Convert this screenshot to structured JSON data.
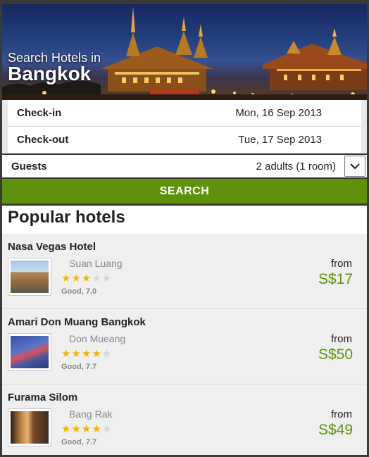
{
  "hero": {
    "subtitle": "Search Hotels in",
    "city": "Bangkok"
  },
  "form": {
    "checkin": {
      "label": "Check-in",
      "value": "Mon, 16 Sep 2013"
    },
    "checkout": {
      "label": "Check-out",
      "value": "Tue, 17 Sep 2013"
    },
    "guests": {
      "label": "Guests",
      "value": "2 adults (1 room)"
    },
    "search_label": "SEARCH"
  },
  "popular": {
    "title": "Popular hotels",
    "hotels": [
      {
        "name": "Nasa Vegas Hotel",
        "area": "Suan Luang",
        "stars": 3,
        "rating": "Good, 7.0",
        "from": "from",
        "price": "S$17"
      },
      {
        "name": "Amari Don Muang Bangkok",
        "area": "Don Mueang",
        "stars": 4,
        "rating": "Good, 7.7",
        "from": "from",
        "price": "S$50"
      },
      {
        "name": "Furama Silom",
        "area": "Bang Rak",
        "stars": 4,
        "rating": "Good, 7.7",
        "from": "from",
        "price": "S$49"
      }
    ]
  },
  "colors": {
    "accent": "#5e920b",
    "star": "#f3b500"
  }
}
